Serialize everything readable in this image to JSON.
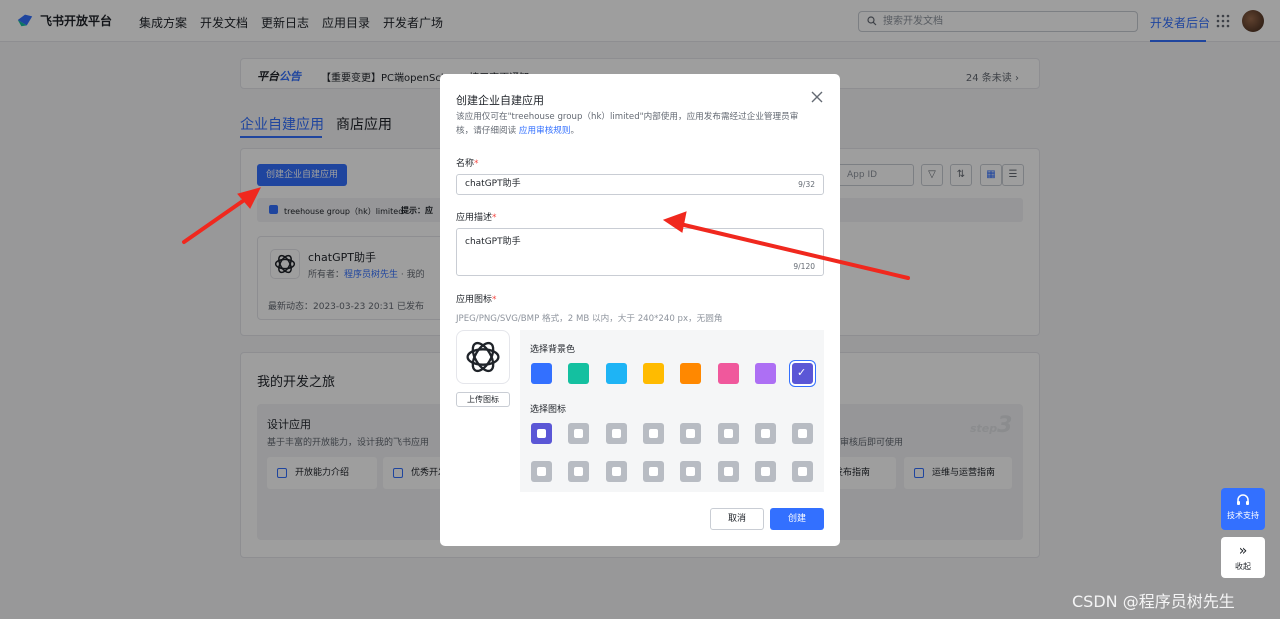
{
  "topnav": {
    "brand": "飞书开放平台",
    "links": [
      "集成方案",
      "开发文档",
      "更新日志",
      "应用目录",
      "开发者广场"
    ],
    "search_placeholder": "搜索开发文档",
    "dev_console": "开发者后台"
  },
  "notice": {
    "tag_prefix": "平台",
    "tag_suffix": "公告",
    "message": "【重要变更】PC端openScheme接口变更通知",
    "unread": "24 条未读 ›"
  },
  "tabs": [
    "企业自建应用",
    "商店应用"
  ],
  "toolbar": {
    "create_label": "创建企业自建应用",
    "org_name": "treehouse group（hk）limited",
    "tip": "提示：应",
    "appid_placeholder": "App ID"
  },
  "app_card": {
    "name": "chatGPT助手",
    "owner_label": "所有者：",
    "owner_name": "程序员树先生",
    "owner_suffix": "· 我的",
    "recent": "最新动态：2023-03-23 20:31  已发布"
  },
  "journey": {
    "title": "我的开发之旅",
    "design_title": "设计应用",
    "design_desc": "基于丰富的开放能力，设计我的飞书应用",
    "features": [
      "开放能力介绍",
      "优秀开发",
      "发布指南",
      "运维与运营指南"
    ],
    "step": "step",
    "step_num": "3",
    "review_text": "审核后即可使用"
  },
  "modal": {
    "title": "创建企业自建应用",
    "subtitle_1": "该应用仅可在\"treehouse group（hk）limited\"内部使用，应用发布需经过企业管理员审核，请仔细阅读",
    "subtitle_link": "应用审核规则",
    "subtitle_end": "。",
    "name_label": "名称",
    "name_value": "chatGPT助手",
    "name_counter": "9/32",
    "desc_label": "应用描述",
    "desc_value": "chatGPT助手",
    "desc_counter": "9/120",
    "icon_label": "应用图标",
    "icon_hint": "JPEG/PNG/SVG/BMP 格式，2 MB 以内，大于 240*240 px，无圆角",
    "upload_label": "上传图标",
    "bg_section": "选择背景色",
    "icon_section": "选择图标",
    "bg_colors": [
      "#3370ff",
      "#14c0a0",
      "#1eb4f5",
      "#ffbb00",
      "#ff8800",
      "#f0589c",
      "#ad6ff4",
      "#5b57d6"
    ],
    "cancel_label": "取消",
    "create_label": "创建"
  },
  "side": {
    "support_label": "技术支持",
    "collapse_label": "收起"
  },
  "watermark": "CSDN @程序员树先生"
}
